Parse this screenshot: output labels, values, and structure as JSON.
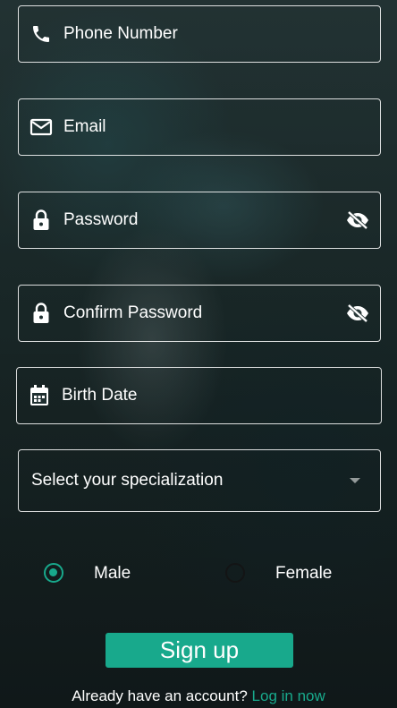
{
  "form": {
    "phone": {
      "placeholder": "Phone Number",
      "icon": "phone-icon"
    },
    "email": {
      "placeholder": "Email",
      "icon": "mail-icon"
    },
    "password": {
      "placeholder": "Password",
      "icon": "lock-icon",
      "toggle_icon": "eye-off-icon"
    },
    "confirm_password": {
      "placeholder": "Confirm Password",
      "icon": "lock-icon",
      "toggle_icon": "eye-off-icon"
    },
    "birth_date": {
      "placeholder": "Birth Date",
      "icon": "calendar-icon"
    },
    "specialization": {
      "selected": "Select your specialization"
    },
    "gender": {
      "options": [
        {
          "label": "Male",
          "selected": true
        },
        {
          "label": "Female",
          "selected": false
        }
      ]
    },
    "signup_label": "Sign up"
  },
  "footer": {
    "prompt": "Already have an account?",
    "login_link": "Log in now"
  },
  "colors": {
    "accent": "#18a98c",
    "text": "#ffffff"
  }
}
